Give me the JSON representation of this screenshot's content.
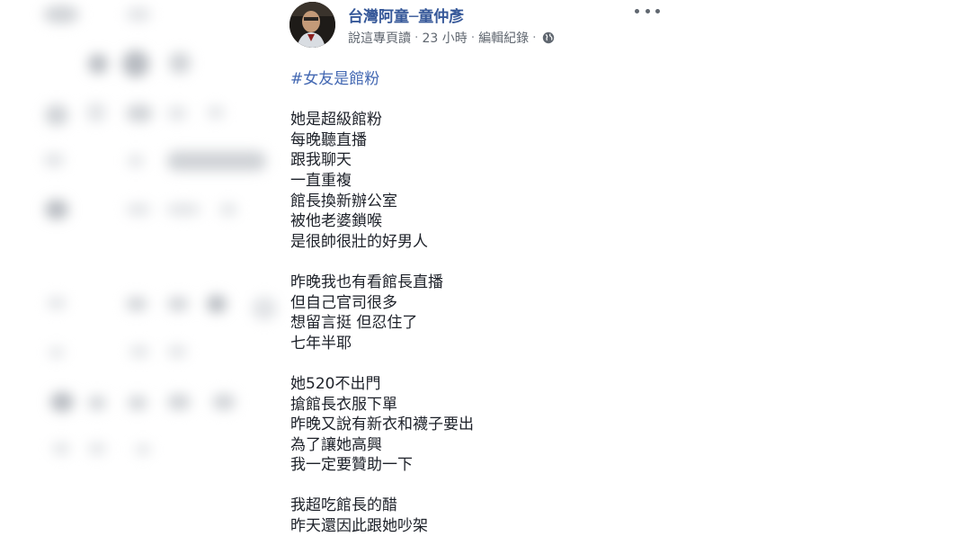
{
  "post": {
    "author_name": "台灣阿童─童仲彥",
    "meta": {
      "say_link": "說這專頁讀",
      "time": "23 小時",
      "edit_history": "編輯紀錄",
      "separator": "·",
      "privacy_icon": "globe-icon"
    },
    "more_icon": "more-options-icon",
    "hashtag": "#女友是館粉",
    "stanzas": [
      [
        "她是超級館粉",
        "每晚聽直播",
        "跟我聊天",
        "一直重複",
        "館長換新辦公室",
        "被他老婆鎖喉",
        "是很帥很壯的好男人"
      ],
      [
        "昨晚我也有看館長直播",
        "但自己官司很多",
        "想留言挺 但忍住了",
        "七年半耶"
      ],
      [
        "她520不出門",
        "搶館長衣服下單",
        "昨晚又說有新衣和襪子要出",
        "為了讓她高興",
        "我一定要贊助一下"
      ],
      [
        "我超吃館長的醋",
        "昨天還因此跟她吵架"
      ]
    ]
  },
  "colors": {
    "author_link": "#365899",
    "hashtag": "#4267b2",
    "body_text": "#1d2129",
    "meta_text": "#606770"
  }
}
